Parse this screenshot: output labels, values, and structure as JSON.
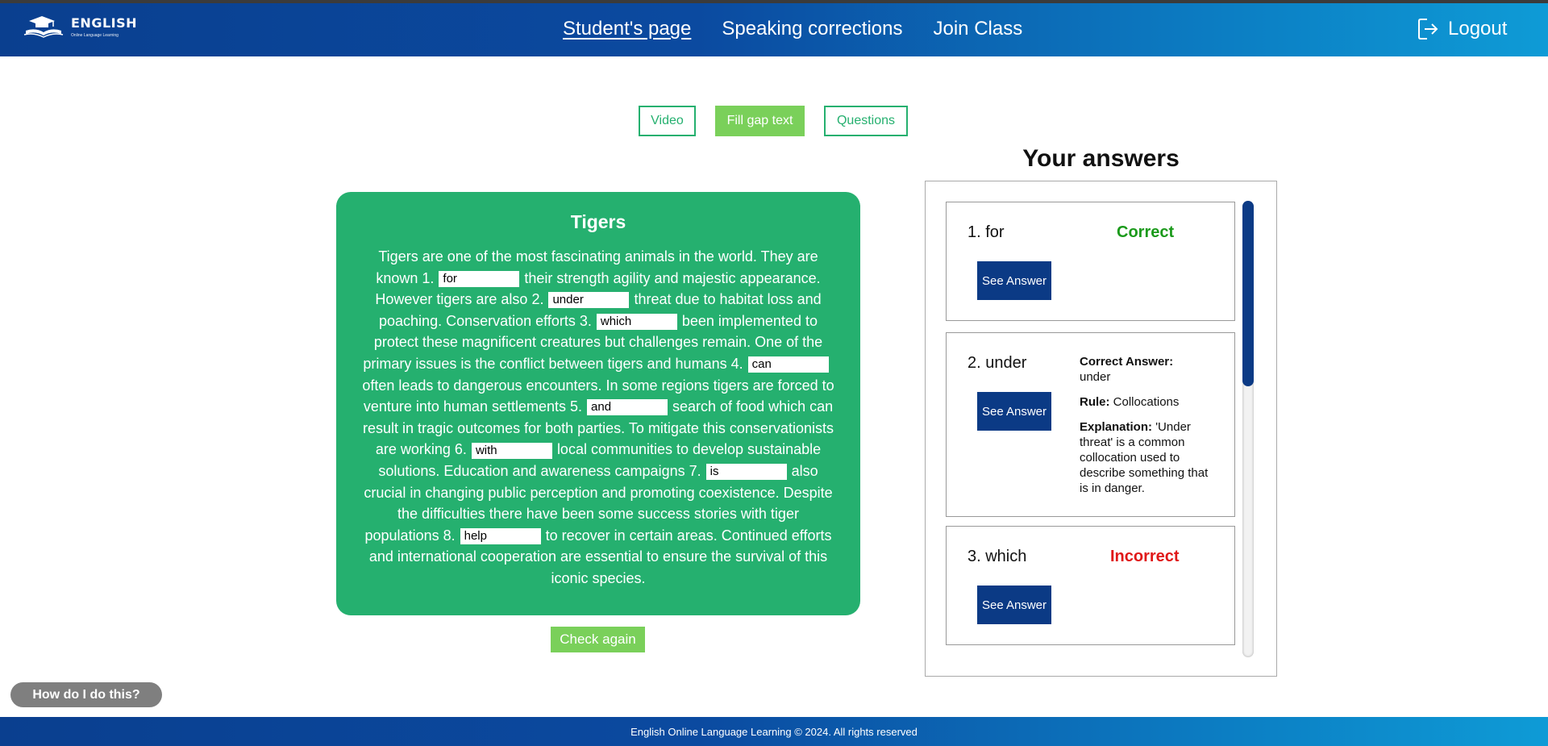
{
  "header": {
    "logo_title": "ENGLISH",
    "logo_subtitle": "Online Language Learning",
    "logo_icon": "graduation-cap-book-icon",
    "nav": [
      "Student's page",
      "Speaking corrections",
      "Join Class"
    ],
    "active_nav": "Student's page",
    "logout_label": "Logout",
    "logout_icon": "logout-icon"
  },
  "tabs": [
    "Video",
    "Fill gap text",
    "Questions"
  ],
  "active_tab": "Fill gap text",
  "text": {
    "title": "Tigers",
    "segments": [
      "Tigers are one of the most fascinating animals in the world. They are known 1.",
      "their strength agility and majestic appearance. However tigers are also 2.",
      "threat due to habitat loss and poaching. Conservation efforts 3.",
      "been implemented to protect these magnificent creatures but challenges remain. One of the primary issues is the conflict between tigers and humans 4.",
      "often leads to dangerous encounters. In some regions tigers are forced to venture into human settlements 5.",
      "search of food which can result in tragic outcomes for both parties. To mitigate this conservationists are working 6.",
      "local communities to develop sustainable solutions. Education and awareness campaigns 7.",
      "also crucial in changing public perception and promoting coexistence. Despite the difficulties there have been some success stories with tiger populations 8.",
      "to recover in certain areas. Continued efforts and international cooperation are essential to ensure the survival of this iconic species."
    ],
    "gaps": [
      "for",
      "under",
      "which",
      "can",
      "and",
      "with",
      "is",
      "help"
    ]
  },
  "check_button": "Check again",
  "answers": {
    "title": "Your answers",
    "see_answer_label": "See Answer",
    "items": [
      {
        "label": "1. for",
        "status": "Correct"
      },
      {
        "label": "2. under",
        "correct_answer_label": "Correct Answer:",
        "correct_answer": "under",
        "rule_label": "Rule:",
        "rule": "Collocations",
        "explanation_label": "Explanation:",
        "explanation": "'Under threat' is a common collocation used to describe something that is in danger."
      },
      {
        "label": "3. which",
        "status": "Incorrect"
      }
    ]
  },
  "help_button": "How do I do this?",
  "footer": "English Online Language Learning © 2024. All rights reserved",
  "colors": {
    "nav_gradient_start": "#0a3f8f",
    "nav_gradient_end": "#0e9bd6",
    "green": "#25b06f",
    "light_green": "#7ad05a",
    "navy_button": "#0b3a85",
    "correct": "#1b9a1b",
    "incorrect": "#e01818"
  }
}
